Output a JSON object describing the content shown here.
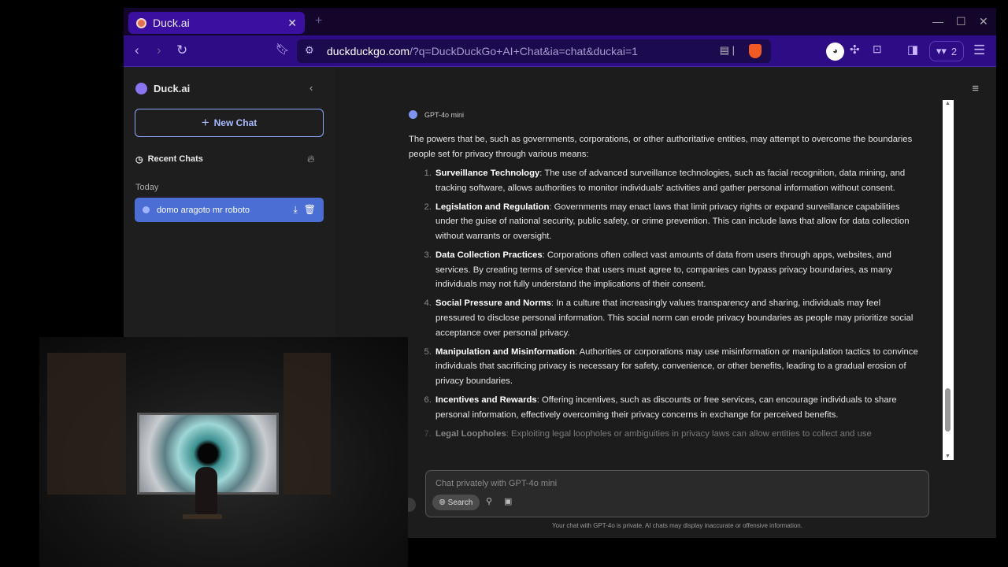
{
  "browser": {
    "tab_title": "Duck.ai",
    "url_domain": "duckduckgo.com",
    "url_path": "/?q=DuckDuckGo+AI+Chat&ia=chat&duckai=1",
    "private_windows": "2"
  },
  "sidebar": {
    "brand": "Duck.ai",
    "new_chat": "New Chat",
    "recent_chats": "Recent Chats",
    "today": "Today",
    "chats": [
      {
        "title": "domo aragoto mr roboto"
      }
    ]
  },
  "chat": {
    "model": "GPT-4o mini",
    "intro": "The powers that be, such as governments, corporations, or other authoritative entities, may attempt to overcome the boundaries people set for privacy through various means:",
    "items": [
      {
        "title": "Surveillance Technology",
        "text": ": The use of advanced surveillance technologies, such as facial recognition, data mining, and tracking software, allows authorities to monitor individuals' activities and gather personal information without consent."
      },
      {
        "title": "Legislation and Regulation",
        "text": ": Governments may enact laws that limit privacy rights or expand surveillance capabilities under the guise of national security, public safety, or crime prevention. This can include laws that allow for data collection without warrants or oversight."
      },
      {
        "title": "Data Collection Practices",
        "text": ": Corporations often collect vast amounts of data from users through apps, websites, and services. By creating terms of service that users must agree to, companies can bypass privacy boundaries, as many individuals may not fully understand the implications of their consent."
      },
      {
        "title": "Social Pressure and Norms",
        "text": ": In a culture that increasingly values transparency and sharing, individuals may feel pressured to disclose personal information. This social norm can erode privacy boundaries as people may prioritize social acceptance over personal privacy."
      },
      {
        "title": "Manipulation and Misinformation",
        "text": ": Authorities or corporations may use misinformation or manipulation tactics to convince individuals that sacrificing privacy is necessary for safety, convenience, or other benefits, leading to a gradual erosion of privacy boundaries."
      },
      {
        "title": "Incentives and Rewards",
        "text": ": Offering incentives, such as discounts or free services, can encourage individuals to share personal information, effectively overcoming their privacy concerns in exchange for perceived benefits."
      },
      {
        "title": "Legal Loopholes",
        "text": ": Exploiting legal loopholes or ambiguities in privacy laws can allow entities to collect and use"
      }
    ],
    "input_placeholder": "Chat privately with GPT-4o mini",
    "search_label": "Search",
    "disclaimer": "Your chat with GPT-4o is private. AI chats may display inaccurate or offensive information."
  }
}
